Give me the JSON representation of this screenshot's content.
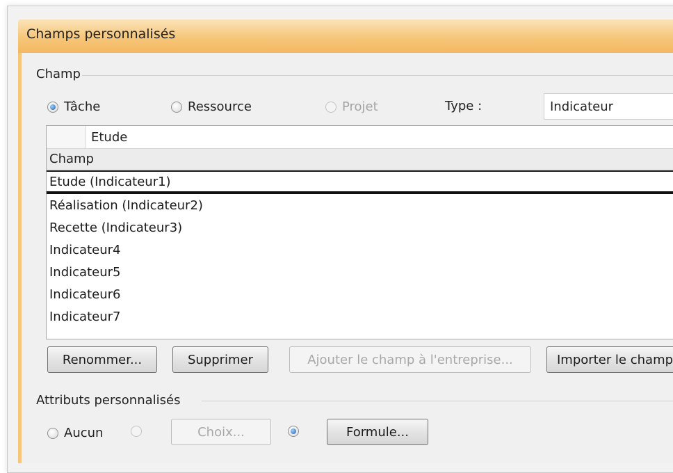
{
  "dialog": {
    "title": "Champs personnalisés"
  },
  "field_group": {
    "label": "Champ",
    "radios": [
      {
        "label": "Tâche",
        "selected": true,
        "enabled": true
      },
      {
        "label": "Ressource",
        "selected": false,
        "enabled": true
      },
      {
        "label": "Projet",
        "selected": false,
        "enabled": false
      }
    ],
    "type_label": "Type :",
    "type_value": "Indicateur"
  },
  "field_list": {
    "edit_value": "Etude",
    "column_header": "Champ",
    "rows": [
      "Etude (Indicateur1)",
      "Réalisation (Indicateur2)",
      "Recette (Indicateur3)",
      "Indicateur4",
      "Indicateur5",
      "Indicateur6",
      "Indicateur7"
    ],
    "selected_index": 0
  },
  "buttons": {
    "rename": "Renommer...",
    "delete": "Supprimer",
    "add_enterprise": "Ajouter le champ à l'entreprise...",
    "import": "Importer le champ"
  },
  "custom_attributes": {
    "label": "Attributs personnalisés",
    "none_label": "Aucun",
    "choices_button": "Choix...",
    "formula_button": "Formule...",
    "selected": "formula"
  },
  "colors": {
    "title_accent": "#f6c67a",
    "radio_selected": "#1d5fb0"
  }
}
